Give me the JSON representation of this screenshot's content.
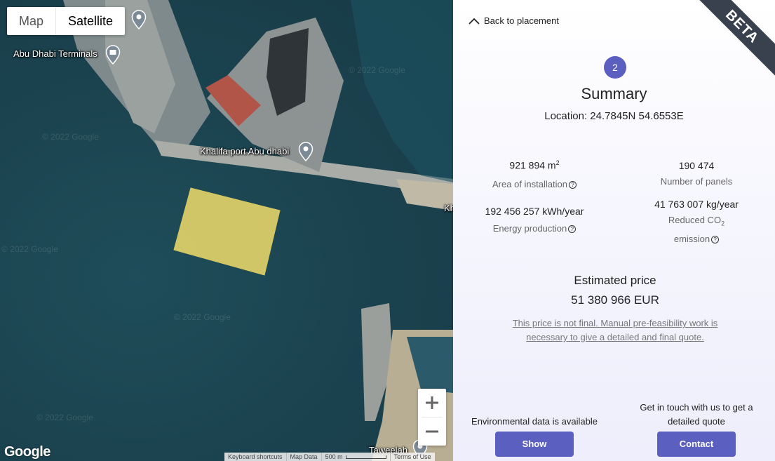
{
  "map": {
    "type_toggle": {
      "map_label": "Map",
      "satellite_label": "Satellite",
      "selected": "Satellite"
    },
    "labels": {
      "terminals": "Abu Dhabi Terminals",
      "port": "Khalifa port Abu dhabi",
      "taweelah": "Taweelah",
      "edge": "Kh"
    },
    "zoom": {
      "in_label": "+",
      "out_label": "−"
    },
    "logo": "Google",
    "footer": {
      "shortcuts": "Keyboard shortcuts",
      "map_data": "Map Data",
      "scale": "500 m",
      "terms": "Terms of Use"
    },
    "watermark": "© 2022 Google",
    "selection_color": "#e4d46a"
  },
  "panel": {
    "back_label": "Back to placement",
    "beta_label": "BETA",
    "step_number": "2",
    "title": "Summary",
    "location": "Location: 24.7845N 54.6553E",
    "stats": {
      "area": {
        "value": "921 894 m",
        "unit_sup": "2",
        "label": "Area of installation"
      },
      "panels": {
        "value": "190 474",
        "label": "Number of panels"
      },
      "energy": {
        "value": "192 456 257 kWh/year",
        "label": "Energy production"
      },
      "co2": {
        "value": "41 763 007 kg/year",
        "label_prefix": "Reduced CO",
        "label_sub": "2",
        "label_suffix": "emission"
      }
    },
    "price": {
      "title": "Estimated price",
      "value": "51 380 966 EUR",
      "disclaimer": "This price is not final. Manual pre-feasibility work is necessary to give a detailed and final quote."
    },
    "cta": {
      "env_text": "Environmental data is available",
      "show_label": "Show",
      "contact_text": "Get in touch with us to get a detailed quote",
      "contact_label": "Contact"
    },
    "accent_color": "#5b5fbf"
  }
}
